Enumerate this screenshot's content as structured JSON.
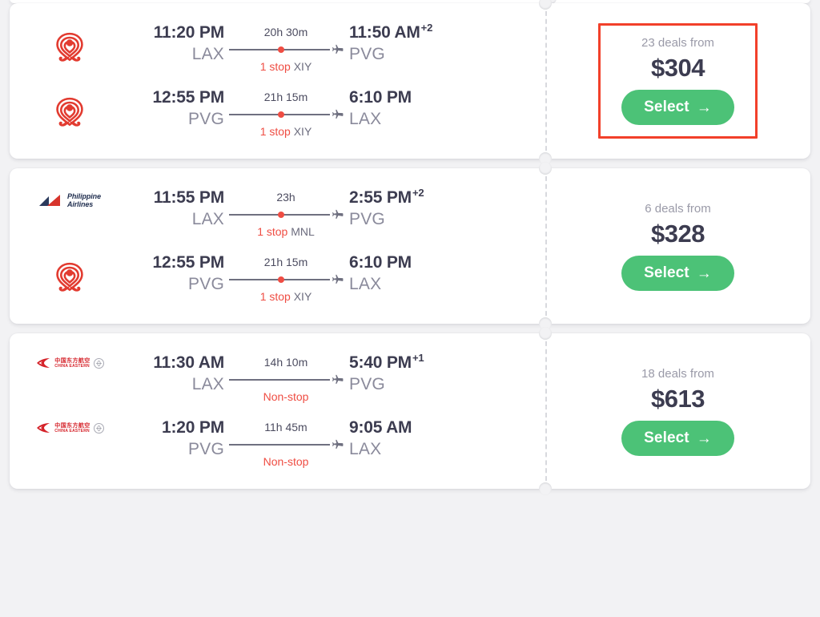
{
  "app": {
    "background": "#f2f2f4",
    "accent_green": "#4cc277",
    "accent_red": "#ef4d43",
    "highlight_box_color": "#f2402a",
    "nonstop_color": "#49c779"
  },
  "highlight": {
    "target_card_index": 0,
    "note": "red annotation box around first card price block"
  },
  "cards": [
    {
      "id": "flight-card-1",
      "highlighted": true,
      "legs": [
        {
          "airline": "china-southern-logo",
          "depart_time": "11:20 PM",
          "depart_code": "LAX",
          "duration": "20h 30m",
          "arrive_time": "11:50 AM",
          "arrive_day_offset": "+2",
          "arrive_code": "PVG",
          "stops_count": "1 stop",
          "stops_airport": "XIY",
          "nonstop": false,
          "stop_dot_position_pct": 50
        },
        {
          "airline": "china-southern-logo",
          "depart_time": "12:55 PM",
          "depart_code": "PVG",
          "duration": "21h 15m",
          "arrive_time": "6:10 PM",
          "arrive_day_offset": "",
          "arrive_code": "LAX",
          "stops_count": "1 stop",
          "stops_airport": "XIY",
          "nonstop": false,
          "stop_dot_position_pct": 50
        }
      ],
      "deals_label": "23 deals from",
      "price": "$304",
      "select_label": "Select",
      "select_arrow": "→"
    },
    {
      "id": "flight-card-2",
      "highlighted": false,
      "legs": [
        {
          "airline": "philippine-airlines-logo",
          "depart_time": "11:55 PM",
          "depart_code": "LAX",
          "duration": "23h",
          "arrive_time": "2:55 PM",
          "arrive_day_offset": "+2",
          "arrive_code": "PVG",
          "stops_count": "1 stop",
          "stops_airport": "MNL",
          "nonstop": false,
          "stop_dot_position_pct": 50
        },
        {
          "airline": "china-southern-logo",
          "depart_time": "12:55 PM",
          "depart_code": "PVG",
          "duration": "21h 15m",
          "arrive_time": "6:10 PM",
          "arrive_day_offset": "",
          "arrive_code": "LAX",
          "stops_count": "1 stop",
          "stops_airport": "XIY",
          "nonstop": false,
          "stop_dot_position_pct": 50
        }
      ],
      "deals_label": "6 deals from",
      "price": "$328",
      "select_label": "Select",
      "select_arrow": "→"
    },
    {
      "id": "flight-card-3",
      "highlighted": false,
      "legs": [
        {
          "airline": "china-eastern-logo",
          "depart_time": "11:30 AM",
          "depart_code": "LAX",
          "duration": "14h 10m",
          "arrive_time": "5:40 PM",
          "arrive_day_offset": "+1",
          "arrive_code": "PVG",
          "stops_count": "Non-stop",
          "stops_airport": "",
          "nonstop": true,
          "stop_dot_position_pct": 50
        },
        {
          "airline": "china-eastern-logo",
          "depart_time": "1:20 PM",
          "depart_code": "PVG",
          "duration": "11h 45m",
          "arrive_time": "9:05 AM",
          "arrive_day_offset": "",
          "arrive_code": "LAX",
          "stops_count": "Non-stop",
          "stops_airport": "",
          "nonstop": true,
          "stop_dot_position_pct": 50
        }
      ],
      "deals_label": "18 deals from",
      "price": "$613",
      "select_label": "Select",
      "select_arrow": "→"
    }
  ],
  "logos": {
    "philippine_airlines": {
      "line1": "Philippine",
      "line2": "Airlines"
    },
    "china_eastern": {
      "cn": "中国东方航空",
      "en": "CHINA EASTERN"
    }
  }
}
